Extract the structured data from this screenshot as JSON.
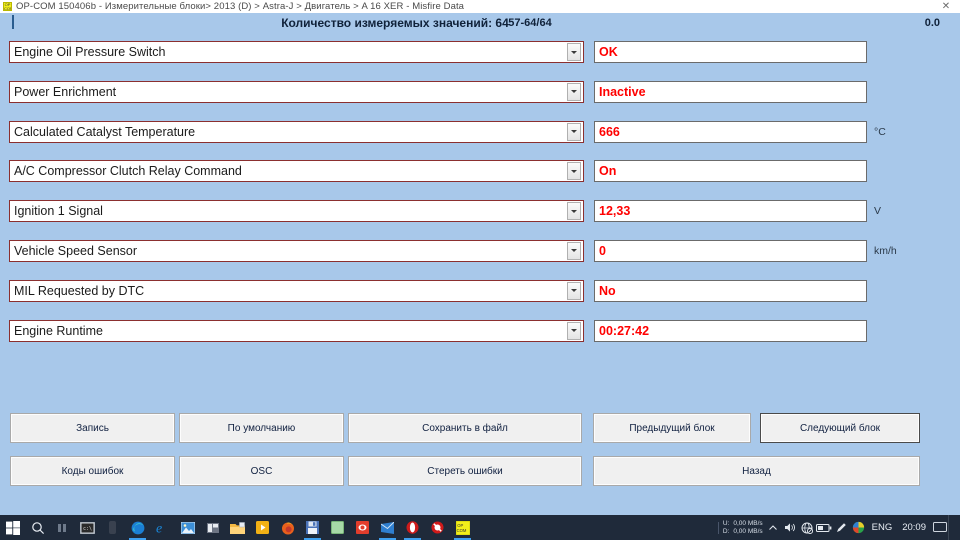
{
  "window": {
    "title": "OP-COM 150406b - Измерительные блоки> 2013 (D) > Astra-J > Двигатель > A 16 XER - Misfire Data",
    "app_icon": "opcom-icon",
    "close_label": "✕"
  },
  "header": {
    "title": "Количество измеряемых значений: 64",
    "range": "57-64/64",
    "value": "0.0"
  },
  "rows": [
    {
      "param": "Engine Oil Pressure Switch",
      "value": "OK",
      "unit": ""
    },
    {
      "param": "Power Enrichment",
      "value": "Inactive",
      "unit": ""
    },
    {
      "param": "Calculated Catalyst Temperature",
      "value": "666",
      "unit": "°C"
    },
    {
      "param": "A/C Compressor Clutch Relay Command",
      "value": "On",
      "unit": ""
    },
    {
      "param": "Ignition 1 Signal",
      "value": "12,33",
      "unit": "V"
    },
    {
      "param": "Vehicle Speed Sensor",
      "value": "0",
      "unit": "km/h"
    },
    {
      "param": "MIL Requested by DTC",
      "value": "No",
      "unit": ""
    },
    {
      "param": "Engine Runtime",
      "value": "00:27:42",
      "unit": ""
    }
  ],
  "buttons": {
    "record": "Запись",
    "default": "По умолчанию",
    "save_to_file": "Сохранить в файл",
    "previous_block": "Предыдущий блок",
    "next_block": "Следующий блок",
    "error_codes": "Коды ошибок",
    "osc": "OSC",
    "clear_errors": "Стереть ошибки",
    "back": "Назад"
  },
  "taskbar": {
    "start": "start-icon",
    "search": "search-icon",
    "task_view": "task-view-icon",
    "apps": [
      {
        "name": "cmd",
        "color": "#2b2b2b"
      },
      {
        "name": "dark-app",
        "color": "#3a4250"
      },
      {
        "name": "edge",
        "color": "#2b8fd6"
      },
      {
        "name": "internet-explorer",
        "color": "#1a7dd6"
      },
      {
        "name": "photos",
        "color": "#3a8fd0"
      },
      {
        "name": "office",
        "color": "#5a6270"
      },
      {
        "name": "file-explorer",
        "color": "#f5b23c"
      },
      {
        "name": "media-player",
        "color": "#f3b519"
      },
      {
        "name": "firefox",
        "color": "#e66000"
      },
      {
        "name": "save-app",
        "color": "#3f6fb5"
      },
      {
        "name": "notepad",
        "color": "#9fd99f"
      },
      {
        "name": "red-app",
        "color": "#e03b2c"
      },
      {
        "name": "mail",
        "color": "#2f7fd0"
      },
      {
        "name": "opera",
        "color": "#cf1f1f"
      },
      {
        "name": "blocked-app",
        "color": "#d11b1b"
      },
      {
        "name": "opcom",
        "color": "#f2ef1b"
      }
    ],
    "net_up_label": "U:",
    "net_down_label": "D:",
    "net_up_rate": "0,00 MB/s",
    "net_down_rate": "0,00 MB/s",
    "tray": [
      "chevron-up-icon",
      "volume-icon",
      "network-icon",
      "battery-icon",
      "pen-icon",
      "graphics-icon"
    ],
    "language": "ENG",
    "clock": "20:09",
    "show_desktop": "show-desktop-button"
  }
}
